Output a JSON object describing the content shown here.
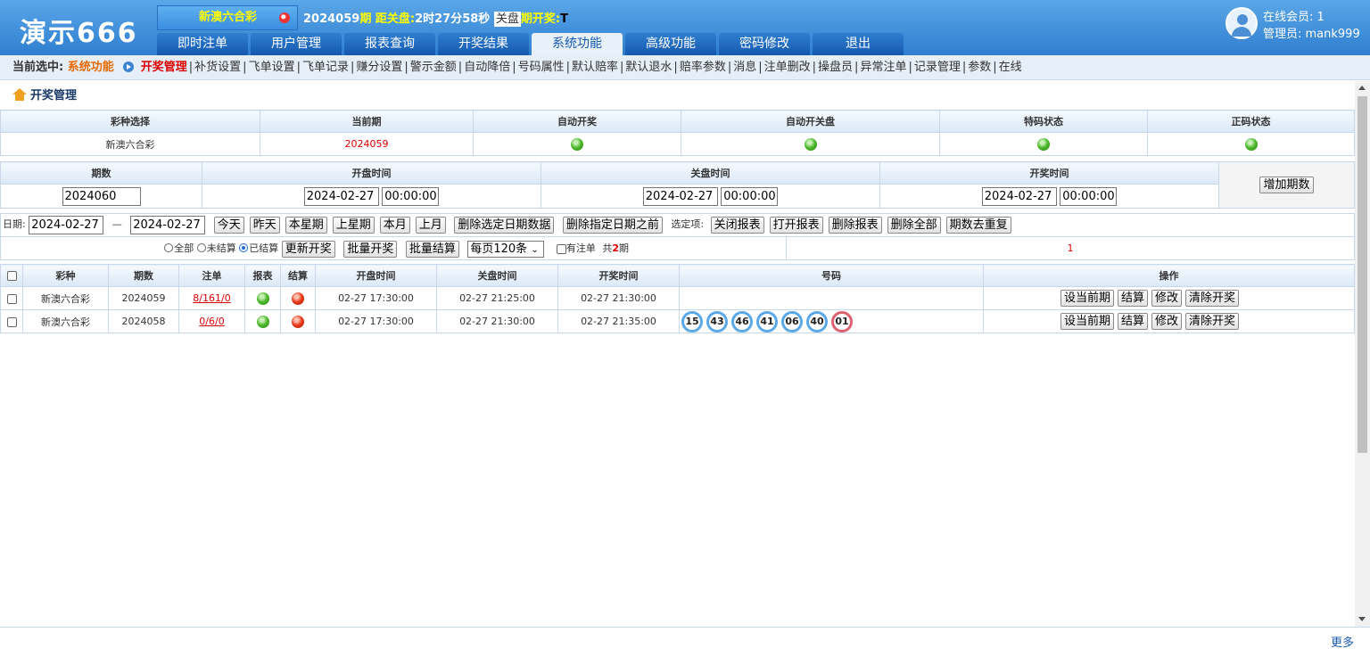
{
  "logo": "演示666",
  "header": {
    "lottery": "新澳六合彩",
    "period": "2024059",
    "period_suffix": "期",
    "countdown_label": "距关盘:",
    "countdown_value": "2时27分58秒",
    "close_label": "关盘",
    "draw_label": "期开奖:",
    "draw_value": "T"
  },
  "nav": {
    "tabs": [
      "即时注单",
      "用户管理",
      "报表查询",
      "开奖结果",
      "系统功能",
      "高级功能",
      "密码修改",
      "退出"
    ],
    "active_index": 4
  },
  "user": {
    "online": "在线会员: 1",
    "admin": "管理员: mank999"
  },
  "subnav": {
    "current_label": "当前选中:",
    "current_value": "系统功能",
    "active_item": "开奖管理",
    "items": [
      "补货设置",
      "飞单设置",
      "飞单记录",
      "赚分设置",
      "警示金额",
      "自动降倍",
      "号码属性",
      "默认赔率",
      "默认退水",
      "赔率参数",
      "消息",
      "注单删改",
      "操盘员",
      "异常注单",
      "记录管理",
      "参数",
      "在线"
    ]
  },
  "page_title": "开奖管理",
  "status_table": {
    "headers": [
      "彩种选择",
      "当前期",
      "自动开奖",
      "自动开关盘",
      "特码状态",
      "正码状态"
    ],
    "lottery": "新澳六合彩",
    "current_period": "2024059"
  },
  "period_table": {
    "headers": [
      "期数",
      "开盘时间",
      "关盘时间",
      "开奖时间"
    ],
    "period_value": "2024060",
    "open_date": "2024-02-27",
    "open_time": "00:00:00",
    "close_date": "2024-02-27",
    "close_time": "00:00:00",
    "draw_date": "2024-02-27",
    "draw_time": "00:00:00",
    "add_button": "增加期数"
  },
  "filter": {
    "date_label": "日期:",
    "date_from": "2024-02-27",
    "dash": "—",
    "date_to": "2024-02-27",
    "quick": [
      "今天",
      "昨天",
      "本星期",
      "上星期",
      "本月",
      "上月"
    ],
    "delete_range": "删除选定日期数据",
    "delete_before": "删除指定日期之前",
    "option_label": "选定项:",
    "actions": [
      "关闭报表",
      "打开报表",
      "删除报表",
      "删除全部",
      "期数去重复"
    ],
    "radio_all": "全部",
    "radio_unsettled": "未结算",
    "radio_settled": "已结算",
    "update_btn": "更新开奖",
    "batch_draw": "批量开奖",
    "batch_settle": "批量结算",
    "per_page": "每页120条",
    "has_bet": "有注单",
    "total_prefix": "共",
    "total_count": "2",
    "total_suffix": "期",
    "page_num": "1"
  },
  "results": {
    "headers": [
      "彩种",
      "期数",
      "注单",
      "报表",
      "结算",
      "开盘时间",
      "关盘时间",
      "开奖时间",
      "号码",
      "操作"
    ],
    "rows": [
      {
        "lottery": "新澳六合彩",
        "period": "2024059",
        "bets": "8/161/0",
        "open": "02-27 17:30:00",
        "close": "02-27 21:25:00",
        "draw": "02-27 21:30:00",
        "numbers": []
      },
      {
        "lottery": "新澳六合彩",
        "period": "2024058",
        "bets": "0/6/0",
        "open": "02-27 17:30:00",
        "close": "02-27 21:30:00",
        "draw": "02-27 21:35:00",
        "numbers": [
          "15",
          "43",
          "46",
          "41",
          "06",
          "40"
        ],
        "special": "01"
      }
    ],
    "row_actions": [
      "设当前期",
      "结算",
      "修改",
      "清除开奖"
    ]
  },
  "footer": {
    "more": "更多"
  },
  "colors": {
    "header_blue": "#2f7fd0",
    "accent_orange": "#e86a00",
    "alert_red": "#dd0000",
    "status_green": "#4cb82a",
    "status_red": "#e83a1a"
  }
}
